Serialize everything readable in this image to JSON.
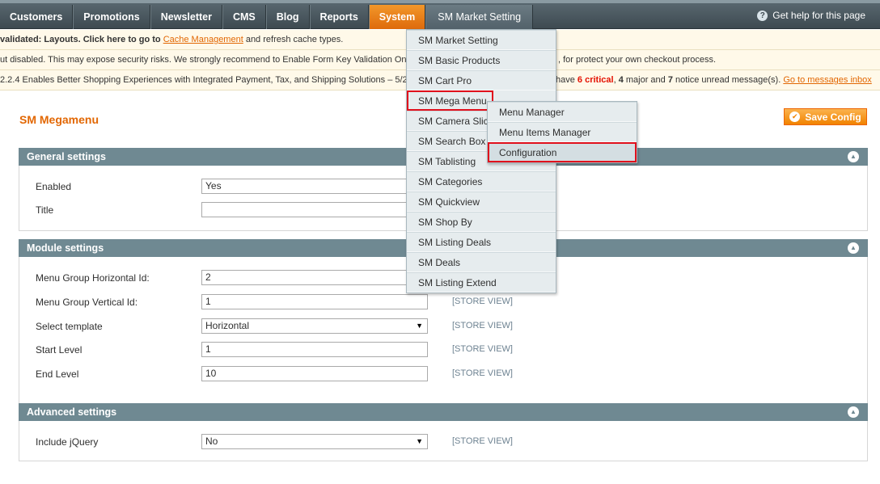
{
  "nav": {
    "items": [
      "Customers",
      "Promotions",
      "Newsletter",
      "CMS",
      "Blog",
      "Reports",
      "System",
      "SM Market Setting"
    ],
    "help": "Get help for this page"
  },
  "notices": {
    "n1_pre": "validated: Layouts. Click here to go to ",
    "n1_link": "Cache Management",
    "n1_post": " and refresh cache types.",
    "n2": "ut disabled. This may expose security risks. We strongly recommend to Enable Form Key Validation On",
    "n2_tail": ", for protect your own checkout process.",
    "n3": "2.2.4 Enables Better Shopping Experiences with Integrated Payment, Tax, and Shipping Solutions – 5/2",
    "n3_have": "have ",
    "n3_critical": "6 critical",
    "n3_sep1": ", ",
    "n3_major_num": "4",
    "n3_major": " major and ",
    "n3_notice_num": "7",
    "n3_notice": " notice unread message(s). ",
    "n3_link": "Go to messages inbox"
  },
  "page": {
    "title": "SM Megamenu",
    "save": "Save Config"
  },
  "general": {
    "title": "General settings",
    "enabled_label": "Enabled",
    "enabled_value": "Yes",
    "title_label": "Title",
    "title_value": ""
  },
  "module": {
    "title": "Module settings",
    "rows": [
      {
        "label": "Menu Group Horizontal Id:",
        "value": "2",
        "scope": ""
      },
      {
        "label": "Menu Group Vertical Id:",
        "value": "1",
        "scope": "[STORE VIEW]"
      },
      {
        "label": "Select template",
        "value": "Horizontal",
        "scope": "[STORE VIEW]"
      },
      {
        "label": "Start Level",
        "value": "1",
        "scope": "[STORE VIEW]"
      },
      {
        "label": "End Level",
        "value": "10",
        "scope": "[STORE VIEW]"
      }
    ]
  },
  "advanced": {
    "title": "Advanced settings",
    "jquery_label": "Include jQuery",
    "jquery_value": "No",
    "jquery_scope": "[STORE VIEW]"
  },
  "dropdown": {
    "items": [
      "SM Market Setting",
      "SM Basic Products",
      "SM Cart Pro",
      "SM Mega Menu",
      "SM Camera Slic",
      "SM Search Box",
      "SM Tablisting",
      "SM Categories",
      "SM Quickview",
      "SM Shop By",
      "SM Listing Deals",
      "SM Deals",
      "SM Listing Extend"
    ]
  },
  "submenu": {
    "items": [
      "Menu Manager",
      "Menu Items Manager",
      "Configuration"
    ]
  },
  "icons": {
    "help": "question-circle-icon",
    "save": "check-circle-icon",
    "toggle": "collapse-up-icon",
    "select": "dropdown-arrow-icon"
  }
}
